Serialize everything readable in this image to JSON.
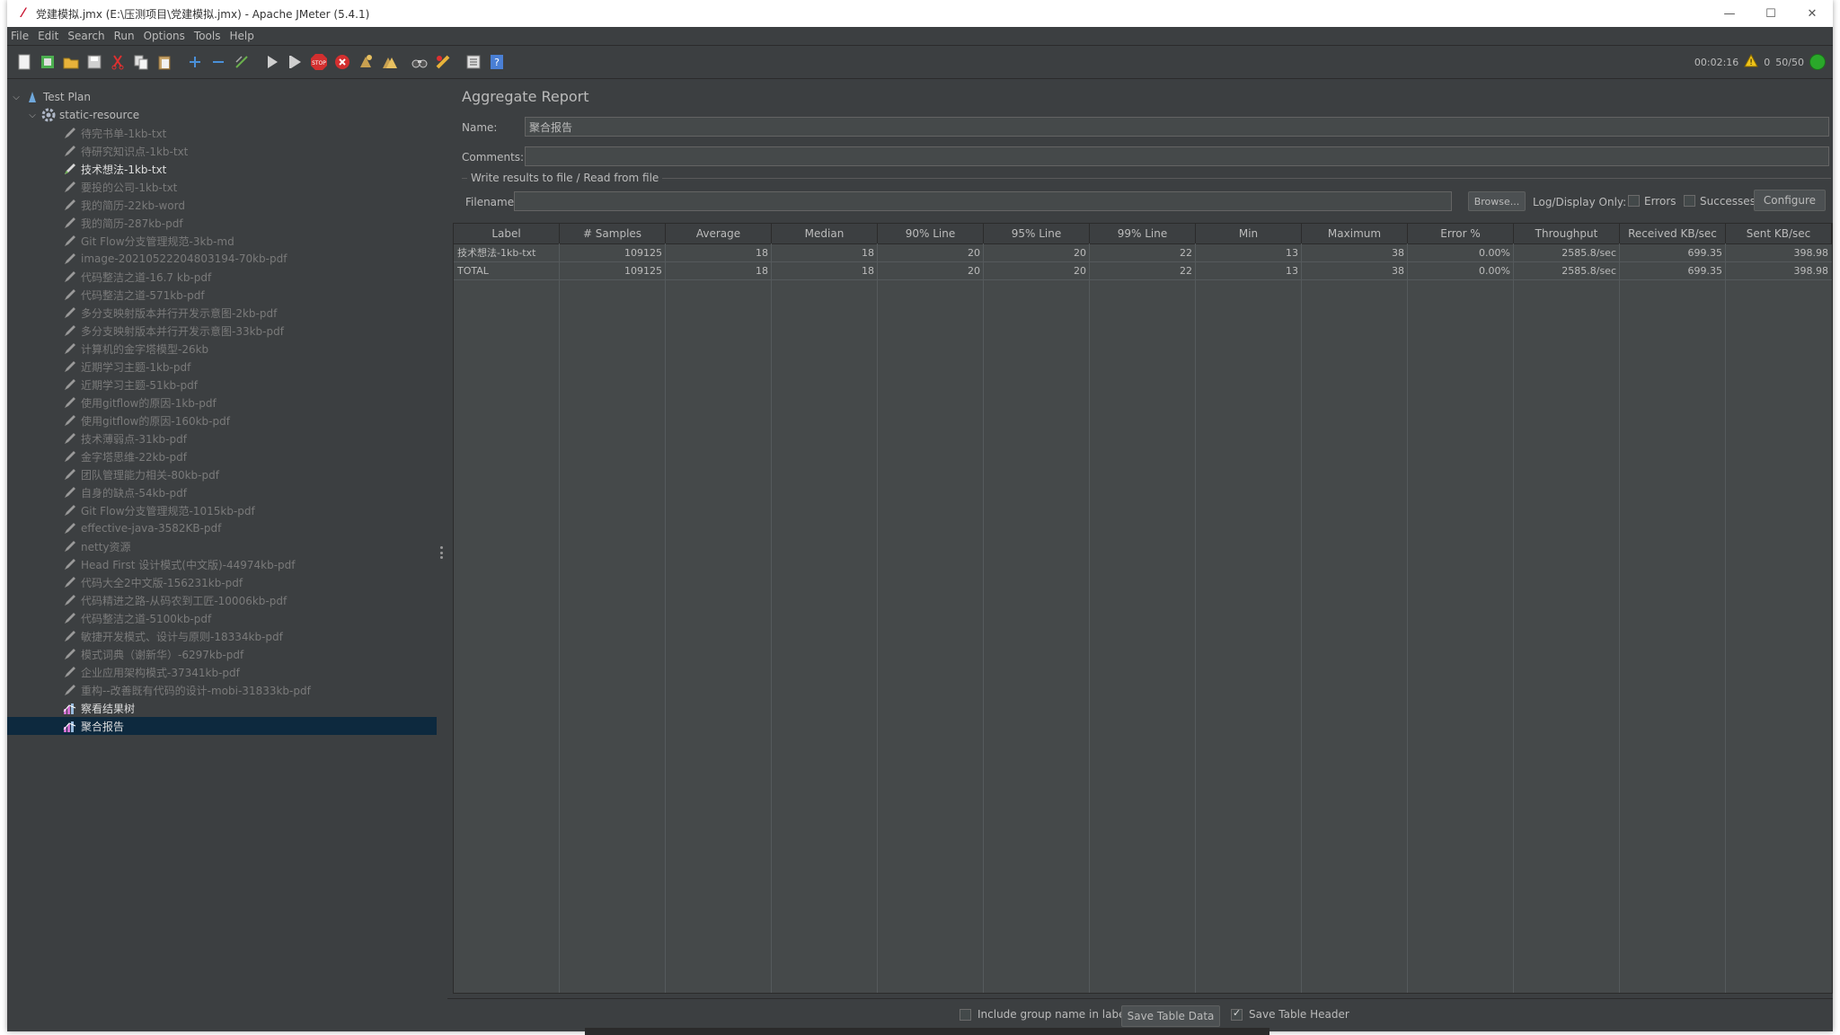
{
  "window": {
    "title": "党建模拟.jmx (E:\\压测项目\\党建模拟.jmx) - Apache JMeter (5.4.1)",
    "controls": [
      "—",
      "☐",
      "✕"
    ]
  },
  "menu": [
    {
      "label": "File"
    },
    {
      "label": "Edit"
    },
    {
      "label": "Search"
    },
    {
      "label": "Run"
    },
    {
      "label": "Options"
    },
    {
      "label": "Tools"
    },
    {
      "label": "Help"
    }
  ],
  "status": {
    "elapsed": "00:02:16",
    "warnings": "0",
    "threads": "50/50"
  },
  "tree": {
    "root": "Test Plan",
    "group": "static-resource",
    "samplers": [
      {
        "label": "待完书单-1kb-txt",
        "state": "disabled"
      },
      {
        "label": "待研究知识点-1kb-txt",
        "state": "disabled"
      },
      {
        "label": "技术想法-1kb-txt",
        "state": "enabled"
      },
      {
        "label": "要投的公司-1kb-txt",
        "state": "disabled"
      },
      {
        "label": "我的简历-22kb-word",
        "state": "disabled"
      },
      {
        "label": "我的简历-287kb-pdf",
        "state": "disabled"
      },
      {
        "label": "Git Flow分支管理规范-3kb-md",
        "state": "disabled"
      },
      {
        "label": "image-20210522204803194-70kb-pdf",
        "state": "disabled"
      },
      {
        "label": "代码整洁之道-16.7 kb-pdf",
        "state": "disabled"
      },
      {
        "label": "代码整洁之道-571kb-pdf",
        "state": "disabled"
      },
      {
        "label": "多分支映射版本并行开发示意图-2kb-pdf",
        "state": "disabled"
      },
      {
        "label": "多分支映射版本并行开发示意图-33kb-pdf",
        "state": "disabled"
      },
      {
        "label": "计算机的金字塔模型-26kb",
        "state": "disabled"
      },
      {
        "label": "近期学习主题-1kb-pdf",
        "state": "disabled"
      },
      {
        "label": "近期学习主题-51kb-pdf",
        "state": "disabled"
      },
      {
        "label": "使用gitflow的原因-1kb-pdf",
        "state": "disabled"
      },
      {
        "label": "使用gitflow的原因-160kb-pdf",
        "state": "disabled"
      },
      {
        "label": "技术薄弱点-31kb-pdf",
        "state": "disabled"
      },
      {
        "label": "金字塔思维-22kb-pdf",
        "state": "disabled"
      },
      {
        "label": "团队管理能力相关-80kb-pdf",
        "state": "disabled"
      },
      {
        "label": "自身的缺点-54kb-pdf",
        "state": "disabled"
      },
      {
        "label": "Git Flow分支管理规范-1015kb-pdf",
        "state": "disabled"
      },
      {
        "label": "effective-java-3582KB-pdf",
        "state": "disabled"
      },
      {
        "label": "netty资源",
        "state": "disabled"
      },
      {
        "label": "Head First 设计模式(中文版)-44974kb-pdf",
        "state": "disabled"
      },
      {
        "label": "代码大全2中文版-156231kb-pdf",
        "state": "disabled"
      },
      {
        "label": "代码精进之路-从码农到工匠-10006kb-pdf",
        "state": "disabled"
      },
      {
        "label": "代码整洁之道-5100kb-pdf",
        "state": "disabled"
      },
      {
        "label": "敏捷开发模式、设计与原则-18334kb-pdf",
        "state": "disabled"
      },
      {
        "label": "模式词典（谢新华）-6297kb-pdf",
        "state": "disabled"
      },
      {
        "label": "企业应用架构模式-37341kb-pdf",
        "state": "disabled"
      },
      {
        "label": "重构--改善既有代码的设计-mobi-31833kb-pdf",
        "state": "disabled"
      }
    ],
    "listeners": [
      {
        "label": "察看结果树",
        "selected": false
      },
      {
        "label": "聚合报告",
        "selected": true
      }
    ]
  },
  "panel": {
    "title": "Aggregate Report",
    "name_label": "Name:",
    "name_value": "聚合报告",
    "comments_label": "Comments:",
    "comments_value": "",
    "file_group_title": "Write results to file / Read from file",
    "filename_label": "Filename",
    "filename_value": "",
    "browse_label": "Browse...",
    "log_display_label": "Log/Display Only:",
    "errors_label": "Errors",
    "successes_label": "Successes",
    "configure_label": "Configure"
  },
  "table": {
    "columns": [
      "Label",
      "# Samples",
      "Average",
      "Median",
      "90% Line",
      "95% Line",
      "99% Line",
      "Min",
      "Maximum",
      "Error %",
      "Throughput",
      "Received KB/sec",
      "Sent KB/sec"
    ],
    "rows": [
      [
        "技术想法-1kb-txt",
        "109125",
        "18",
        "18",
        "20",
        "20",
        "22",
        "13",
        "38",
        "0.00%",
        "2585.8/sec",
        "699.35",
        "398.98"
      ],
      [
        "TOTAL",
        "109125",
        "18",
        "18",
        "20",
        "20",
        "22",
        "13",
        "38",
        "0.00%",
        "2585.8/sec",
        "699.35",
        "398.98"
      ]
    ]
  },
  "bottom": {
    "include_group_label": "Include group name in label?",
    "include_group_checked": false,
    "save_table_data_label": "Save Table Data",
    "save_table_header_label": "Save Table Header",
    "save_table_header_checked": true
  }
}
